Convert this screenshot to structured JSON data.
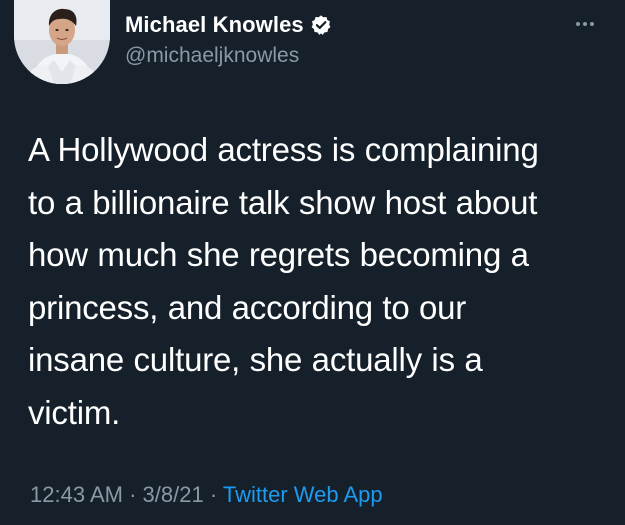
{
  "author": {
    "display_name": "Michael Knowles",
    "handle": "@michaeljknowles",
    "verified": true,
    "avatar_icon": "profile-photo"
  },
  "tweet": {
    "text": "A Hollywood actress is complaining\nto a billionaire talk show host about\nhow much she regrets becoming a\nprincess, and according to our\ninsane culture, she actually is a\nvictim."
  },
  "meta": {
    "time": "12:43 AM",
    "separator": "·",
    "date": "3/8/21",
    "source": "Twitter Web App"
  },
  "icons": {
    "more": "more-horizontal-icon",
    "verified": "verified-badge-icon"
  },
  "colors": {
    "background": "#15202b",
    "primary_text": "#ffffff",
    "secondary_text": "#8b98a5",
    "link": "#1d9bf0",
    "verified": "#ffffff"
  }
}
